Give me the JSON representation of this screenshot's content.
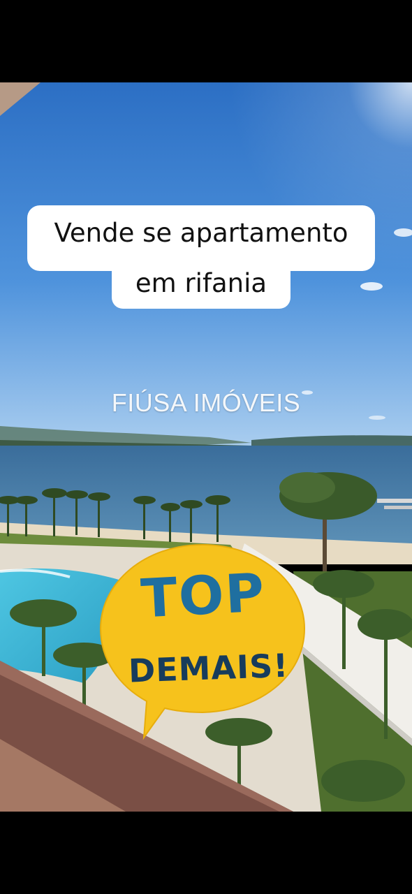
{
  "caption": {
    "line1": "Vende se apartamento",
    "line2": "em rifania"
  },
  "watermark": "FIÚSA IMÓVEIS",
  "sticker": {
    "line1": "TOP",
    "line2": "DEMAIS!",
    "fill_color": "#f6c21c",
    "text_color": "#1f6fa0"
  },
  "colors": {
    "sky": "#3f86d6",
    "water": "#3b6e9a",
    "pool": "#3ab7d6",
    "lawn": "#6a8a3a",
    "sand": "#e8dcc6"
  }
}
